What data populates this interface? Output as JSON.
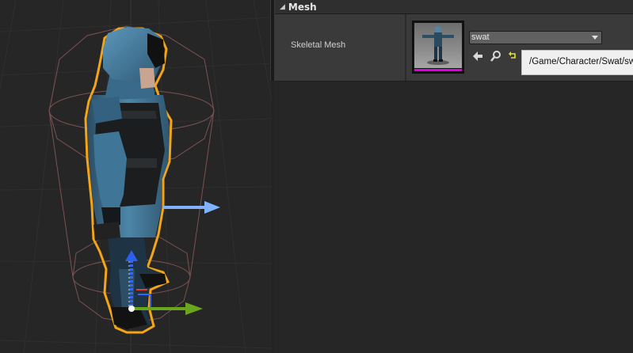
{
  "details": {
    "section_title": "Mesh",
    "property_label": "Skeletal Mesh",
    "asset_name": "swat",
    "asset_path_tooltip": "/Game/Character/Swat/swat"
  },
  "icons": {
    "section_collapse": "triangle-down-icon",
    "use_selected": "arrow-left-icon",
    "browse": "magnifier-icon",
    "reset": "reset-arrow-icon",
    "dropdown": "chevron-down-icon"
  },
  "colors": {
    "selection_outline": "#f2a516",
    "gizmo_x": "#7fb2ff",
    "gizmo_y": "#6aa51e",
    "gizmo_z": "#2f64ff",
    "thumbnail_bar": "#e000e0",
    "collision_capsule": "#8a5a5a"
  }
}
